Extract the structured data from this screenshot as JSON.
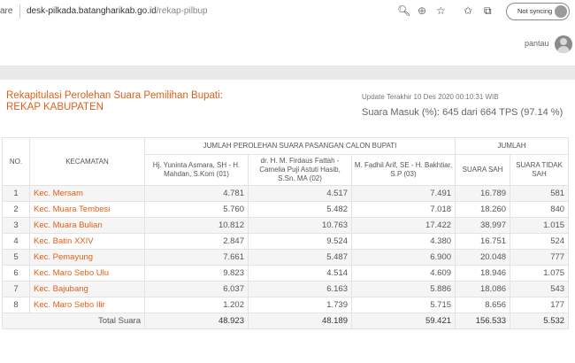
{
  "browser": {
    "url_prefix": "are",
    "url_domain": "desk-pilkada.batangharikab.go.id",
    "url_path": "/rekap-pilbup",
    "sync_label": "Not syncing"
  },
  "header": {
    "user_name": "pantau"
  },
  "page": {
    "title_line1": "Rekapitulasi Perolehan Suara Pemilihan Bupati:",
    "title_line2": "REKAP KABUPATEN",
    "update_text": "Update Terakhir 10 Des 2020 00:10:31 WIB",
    "suara_masuk": "Suara Masuk (%): 645 dari 664 TPS (97.14 %)"
  },
  "table": {
    "headers": {
      "no": "NO.",
      "kecamatan": "KECAMATAN",
      "group_candidates": "JUMLAH PEROLEHAN SUARA PASANGAN CALON BUPATI",
      "group_jumlah": "JUMLAH",
      "candidate1": "Hj. Yuninta Asmara, SH - H. Mahdan, S.Kom (01)",
      "candidate2": "dr. H. M. Firdaus Fattah - Camelia Puji Astuti Hasib, S.Sn. MA (02)",
      "candidate3": "M. Fadhil Arif, SE - H. Bakhtiar, S.P (03)",
      "suara_sah": "SUARA SAH",
      "suara_tidak_sah": "SUARA TIDAK SAH"
    },
    "rows": [
      {
        "no": "1",
        "kecamatan": "Kec. Mersam",
        "c1": "4.781",
        "c2": "4.517",
        "c3": "7.491",
        "sah": "16.789",
        "tidak_sah": "581"
      },
      {
        "no": "2",
        "kecamatan": "Kec. Muara Tembesi",
        "c1": "5.760",
        "c2": "5.482",
        "c3": "7.018",
        "sah": "18.260",
        "tidak_sah": "840"
      },
      {
        "no": "3",
        "kecamatan": "Kec. Muara Bulian",
        "c1": "10.812",
        "c2": "10.763",
        "c3": "17.422",
        "sah": "38.997",
        "tidak_sah": "1.015"
      },
      {
        "no": "4",
        "kecamatan": "Kec. Batin XXIV",
        "c1": "2.847",
        "c2": "9.524",
        "c3": "4.380",
        "sah": "16.751",
        "tidak_sah": "524"
      },
      {
        "no": "5",
        "kecamatan": "Kec. Pemayung",
        "c1": "7.661",
        "c2": "5.487",
        "c3": "6.900",
        "sah": "20.048",
        "tidak_sah": "777"
      },
      {
        "no": "6",
        "kecamatan": "Kec. Maro Sebo Ulu",
        "c1": "9.823",
        "c2": "4.514",
        "c3": "4.609",
        "sah": "18.946",
        "tidak_sah": "1.075"
      },
      {
        "no": "7",
        "kecamatan": "Kec. Bajubang",
        "c1": "6.037",
        "c2": "6.163",
        "c3": "5.886",
        "sah": "18.086",
        "tidak_sah": "543"
      },
      {
        "no": "8",
        "kecamatan": "Kec. Maro Sebo Ilir",
        "c1": "1.202",
        "c2": "1.739",
        "c3": "5.715",
        "sah": "8.656",
        "tidak_sah": "177"
      }
    ],
    "total": {
      "label": "Total Suara",
      "c1": "48.923",
      "c2": "48.189",
      "c3": "59.421",
      "sah": "156.533",
      "tidak_sah": "5.532"
    }
  }
}
